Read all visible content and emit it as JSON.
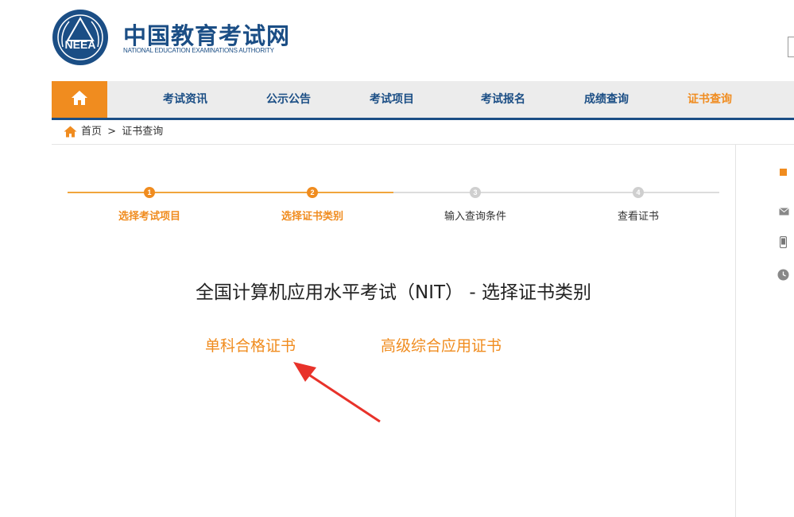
{
  "header": {
    "brand_cn": "中国教育考试网",
    "brand_en": "NATIONAL EDUCATION EXAMINATIONS AUTHORITY",
    "logo_text": "NEEA"
  },
  "nav": {
    "home_icon": "home-icon",
    "items": [
      {
        "label": "考试资讯"
      },
      {
        "label": "公示公告"
      },
      {
        "label": "考试项目"
      },
      {
        "label": "考试报名"
      },
      {
        "label": "成绩查询"
      },
      {
        "label": "证书查询"
      }
    ],
    "active_index": 5
  },
  "breadcrumb": {
    "home": "首页",
    "separator": ">",
    "current": "证书查询"
  },
  "steps": [
    {
      "num": "1",
      "label": "选择考试项目",
      "state": "done"
    },
    {
      "num": "2",
      "label": "选择证书类别",
      "state": "current"
    },
    {
      "num": "3",
      "label": "输入查询条件",
      "state": "todo"
    },
    {
      "num": "4",
      "label": "查看证书",
      "state": "todo"
    }
  ],
  "main": {
    "title": "全国计算机应用水平考试（NIT） - 选择证书类别",
    "options": [
      {
        "label": "单科合格证书"
      },
      {
        "label": "高级综合应用证书"
      }
    ]
  },
  "colors": {
    "brand_blue": "#1b4e85",
    "accent_orange": "#f08c1f",
    "inactive_gray": "#cfcfcf",
    "arrow_red": "#e8322a"
  },
  "sidebar_icons": [
    "mail-icon",
    "phone-icon",
    "clock-icon"
  ]
}
